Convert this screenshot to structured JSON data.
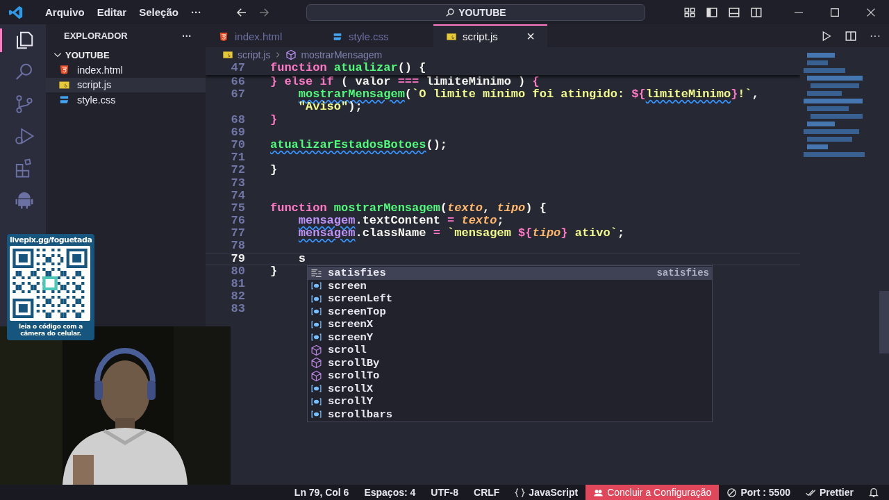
{
  "title_bar": {
    "menus": [
      "Arquivo",
      "Editar",
      "Seleção",
      "···"
    ],
    "search": "YOUTUBE"
  },
  "activity_bar": [
    {
      "kind": "files",
      "selected": true
    },
    {
      "kind": "search",
      "selected": false
    },
    {
      "kind": "branch",
      "selected": false
    },
    {
      "kind": "debug",
      "selected": false
    },
    {
      "kind": "extensions",
      "selected": false
    },
    {
      "kind": "android",
      "selected": false
    }
  ],
  "explorer": {
    "title": "EXPLORADOR",
    "more": "···",
    "folder": "YOUTUBE",
    "expanded": true,
    "files": [
      {
        "name": "index.html",
        "kind": "html",
        "selected": false
      },
      {
        "name": "script.js",
        "kind": "js",
        "selected": true
      },
      {
        "name": "style.css",
        "kind": "css",
        "selected": false
      }
    ]
  },
  "tabs": [
    {
      "label": "index.html",
      "kind": "html",
      "selected": false
    },
    {
      "label": "style.css",
      "kind": "css",
      "selected": false
    },
    {
      "label": "script.js",
      "kind": "js",
      "selected": true,
      "close": "×"
    }
  ],
  "editor_actions": {
    "more": "···"
  },
  "breadcrumb": [
    "script.js",
    "mostrarMensagem"
  ],
  "editor": {
    "sticky_line": {
      "number": "47",
      "tokens": [
        {
          "text": "function ",
          "kind": "kw"
        },
        {
          "text": "atualizar",
          "kind": "fn"
        },
        {
          "text": "() {"
        }
      ]
    },
    "lines": [
      {
        "number": "66",
        "current": false,
        "tokens": [
          {
            "text": "} else if",
            "kind": "kw"
          },
          {
            "text": " ( valor "
          },
          {
            "text": "===",
            "kind": "kw"
          },
          {
            "text": " limiteMinimo ) "
          },
          {
            "text": "{",
            "kind": "kw"
          }
        ]
      },
      {
        "number": "67",
        "current": false,
        "tokens": [
          {
            "text": "    mostrarMensagem",
            "kind": "fn",
            "squiggle": true
          },
          {
            "text": "("
          },
          {
            "text": "`O limite mínimo foi atingido: ",
            "kind": "str"
          },
          {
            "text": "${",
            "kind": "kw"
          },
          {
            "text": "limiteMinimo",
            "kind": "str",
            "squiggle": true
          },
          {
            "text": "}",
            "kind": "kw"
          },
          {
            "text": "!`",
            "kind": "str"
          },
          {
            "text": ","
          }
        ]
      },
      {
        "current": false,
        "tokens": [
          {
            "text": "    \"Aviso\"",
            "kind": "str"
          },
          {
            "text": ");"
          }
        ]
      },
      {
        "number": "68",
        "current": false,
        "tokens": [
          {
            "text": "}",
            "kind": "kw"
          }
        ]
      },
      {
        "number": "69",
        "current": false
      },
      {
        "number": "70",
        "current": false,
        "tokens": [
          {
            "text": "atualizarEstadosBotoes",
            "kind": "fn",
            "squiggle": true
          },
          {
            "text": "();"
          }
        ]
      },
      {
        "number": "71",
        "current": false
      },
      {
        "number": "72",
        "current": false,
        "tokens": [
          {
            "text": "}"
          }
        ]
      },
      {
        "number": "73",
        "current": false
      },
      {
        "number": "74",
        "current": false
      },
      {
        "number": "75",
        "current": false,
        "tokens": [
          {
            "text": "function ",
            "kind": "kw"
          },
          {
            "text": "mostrarMensagem",
            "kind": "fn"
          },
          {
            "text": "("
          },
          {
            "text": "texto",
            "kind": "param"
          },
          {
            "text": ", "
          },
          {
            "text": "tipo",
            "kind": "param"
          },
          {
            "text": ") {"
          }
        ]
      },
      {
        "number": "76",
        "current": false,
        "tokens": [
          {
            "text": "    mensagem",
            "kind": "var",
            "squiggle": true
          },
          {
            "text": ".textContent "
          },
          {
            "text": "= ",
            "kind": "kw"
          },
          {
            "text": "texto",
            "kind": "param"
          },
          {
            "text": ";"
          }
        ]
      },
      {
        "number": "77",
        "current": false,
        "tokens": [
          {
            "text": "    mensagem",
            "kind": "var",
            "squiggle": true
          },
          {
            "text": ".className "
          },
          {
            "text": "= ",
            "kind": "kw"
          },
          {
            "text": "`mensagem ",
            "kind": "str"
          },
          {
            "text": "${",
            "kind": "kw"
          },
          {
            "text": "tipo",
            "kind": "param"
          },
          {
            "text": "}",
            "kind": "kw"
          },
          {
            "text": " ativo`",
            "kind": "str"
          },
          {
            "text": ";"
          }
        ]
      },
      {
        "number": "78",
        "current": false
      },
      {
        "number": "79",
        "current": true,
        "tokens": [
          {
            "text": "    s"
          }
        ]
      },
      {
        "number": "80",
        "current": false,
        "tokens": [
          {
            "text": "}"
          }
        ]
      },
      {
        "number": "81",
        "current": false
      },
      {
        "number": "82",
        "current": false
      },
      {
        "number": "83",
        "current": false
      }
    ]
  },
  "suggestions": [
    {
      "label": "satisfies",
      "kind": "keyword",
      "selected": true,
      "detail": "satisfies"
    },
    {
      "label": "screen",
      "kind": "variable",
      "selected": false
    },
    {
      "label": "screenLeft",
      "kind": "variable",
      "selected": false
    },
    {
      "label": "screenTop",
      "kind": "variable",
      "selected": false
    },
    {
      "label": "screenX",
      "kind": "variable",
      "selected": false
    },
    {
      "label": "screenY",
      "kind": "variable",
      "selected": false
    },
    {
      "label": "scroll",
      "kind": "method",
      "selected": false
    },
    {
      "label": "scrollBy",
      "kind": "method",
      "selected": false
    },
    {
      "label": "scrollTo",
      "kind": "method",
      "selected": false
    },
    {
      "label": "scrollX",
      "kind": "variable",
      "selected": false
    },
    {
      "label": "scrollY",
      "kind": "variable",
      "selected": false
    },
    {
      "label": "scrollbars",
      "kind": "variable",
      "selected": false
    }
  ],
  "status_bar": [
    {
      "text": "Ln 79, Col 6",
      "kind": "plain"
    },
    {
      "text": "Espaços: 4",
      "kind": "plain"
    },
    {
      "text": "UTF-8",
      "kind": "plain"
    },
    {
      "text": "CRLF",
      "kind": "plain"
    },
    {
      "text": "JavaScript",
      "kind": "language"
    },
    {
      "text": "Concluir a Configuração",
      "kind": "alert"
    },
    {
      "text": "Port : 5500",
      "kind": "port"
    },
    {
      "text": "Prettier",
      "kind": "prettier"
    }
  ],
  "qr_overlay": {
    "url": "livepix.gg/foguetada",
    "caption": "leia o código com a câmera do celular."
  }
}
